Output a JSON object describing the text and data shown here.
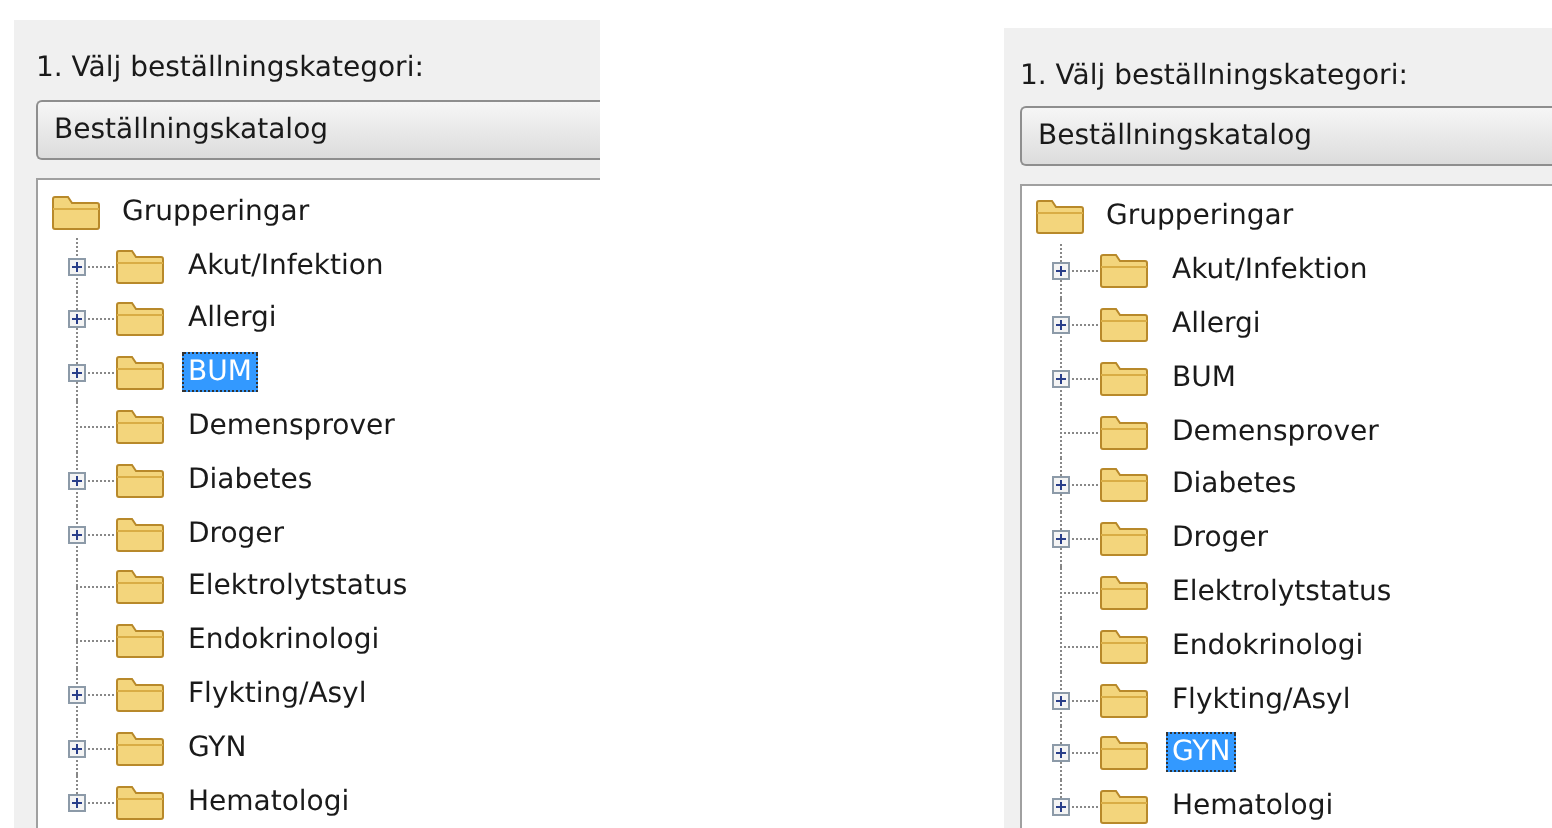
{
  "panels": [
    {
      "label": "1. Välj beställningskategori:",
      "dropdown": {
        "value": "Beställningskatalog"
      },
      "tree": {
        "label": "Grupperingar",
        "selected": false,
        "children": [
          {
            "label": "Akut/Infektion",
            "expandable": true,
            "selected": false
          },
          {
            "label": "Allergi",
            "expandable": true,
            "selected": false
          },
          {
            "label": "BUM",
            "expandable": true,
            "selected": true
          },
          {
            "label": "Demensprover",
            "expandable": false,
            "selected": false
          },
          {
            "label": "Diabetes",
            "expandable": true,
            "selected": false
          },
          {
            "label": "Droger",
            "expandable": true,
            "selected": false
          },
          {
            "label": "Elektrolytstatus",
            "expandable": false,
            "selected": false
          },
          {
            "label": "Endokrinologi",
            "expandable": false,
            "selected": false
          },
          {
            "label": "Flykting/Asyl",
            "expandable": true,
            "selected": false
          },
          {
            "label": "GYN",
            "expandable": true,
            "selected": false
          },
          {
            "label": "Hematologi",
            "expandable": true,
            "selected": false
          }
        ]
      }
    },
    {
      "label": "1. Välj beställningskategori:",
      "dropdown": {
        "value": "Beställningskatalog"
      },
      "tree": {
        "label": "Grupperingar",
        "selected": false,
        "children": [
          {
            "label": "Akut/Infektion",
            "expandable": true,
            "selected": false
          },
          {
            "label": "Allergi",
            "expandable": true,
            "selected": false
          },
          {
            "label": "BUM",
            "expandable": true,
            "selected": false
          },
          {
            "label": "Demensprover",
            "expandable": false,
            "selected": false
          },
          {
            "label": "Diabetes",
            "expandable": true,
            "selected": false
          },
          {
            "label": "Droger",
            "expandable": true,
            "selected": false
          },
          {
            "label": "Elektrolytstatus",
            "expandable": false,
            "selected": false
          },
          {
            "label": "Endokrinologi",
            "expandable": false,
            "selected": false
          },
          {
            "label": "Flykting/Asyl",
            "expandable": true,
            "selected": false
          },
          {
            "label": "GYN",
            "expandable": true,
            "selected": true
          },
          {
            "label": "Hematologi",
            "expandable": true,
            "selected": false
          }
        ]
      }
    }
  ]
}
